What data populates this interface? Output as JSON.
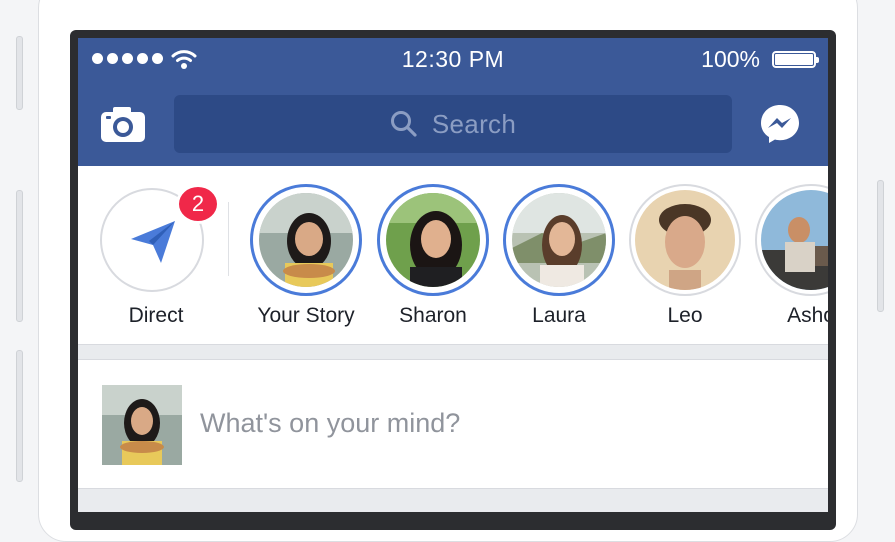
{
  "status_bar": {
    "time": "12:30 PM",
    "battery": "100%"
  },
  "header": {
    "search_placeholder": "Search",
    "camera_icon": "camera-icon",
    "messenger_icon": "messenger-icon"
  },
  "stories": {
    "direct": {
      "label": "Direct",
      "badge": "2",
      "icon": "paper-plane-icon"
    },
    "items": [
      {
        "label": "Your Story"
      },
      {
        "label": "Sharon"
      },
      {
        "label": "Laura"
      },
      {
        "label": "Leo"
      },
      {
        "label": "Asho"
      }
    ]
  },
  "composer": {
    "prompt": "What's on your mind?"
  },
  "colors": {
    "brand_blue": "#3b5998",
    "search_bg": "#2d4a86",
    "story_ring": "#4a7bd9",
    "badge_red": "#f02849"
  }
}
